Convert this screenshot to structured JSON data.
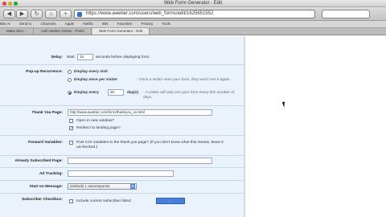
{
  "window": {
    "title": "Web Form Generator - Edit"
  },
  "toolbar": {
    "back_icon": "back-arrow-icon",
    "forward_icon": "forward-arrow-icon",
    "reload_icon": "reload-icon",
    "home_icon": "home-icon",
    "url": "https://www.aweber.com/users/web_forms/edit/1625651552"
  },
  "bookmarks": [
    "Bits Ai",
    "Send to",
    "Channels",
    "Apple",
    "Netflix",
    "BW",
    "Favorites",
    "Privacy",
    "Tools"
  ],
  "tabs": [
    "Make Mon...",
    "Add Aweber Online - Posts",
    "Web Form Generator - Edit"
  ],
  "form": {
    "delay": {
      "label": "Delay:",
      "prefix": "Wait",
      "value": "15",
      "suffix": "seconds before displaying form."
    },
    "recurrence": {
      "label": "Pop-up Recurrence:",
      "opt1": "Display every visit",
      "opt2": "Display once per visitor",
      "opt2_note": "- Once a visitor sees your form, they won't see it again.",
      "opt3_prefix": "Display every",
      "opt3_value": "30",
      "opt3_suffix": "day(s)",
      "opt3_note": "- A visitor will only see your form every this number of days."
    },
    "thankyou": {
      "label": "Thank You Page:",
      "url": "http://www.aweber.com/form/thankyou_vo.html",
      "open_new": "Open in new window?",
      "redirect": "Redirect to landing page?"
    },
    "forward": {
      "label": "Forward Variables:",
      "text": "Post CGI variables to the thank you page? (If you don't know what this means, leave it unchecked.)"
    },
    "already": {
      "label": "Already Subscribed Page:"
    },
    "tracking": {
      "label": "Ad Tracking:"
    },
    "start_on": {
      "label": "Start on Message:",
      "selected": "(Default) 1 autoresponse"
    },
    "subscriber": {
      "label": "Subscriber Checkbox:",
      "text": "Include current subscriber listed",
      "button": "..."
    }
  }
}
